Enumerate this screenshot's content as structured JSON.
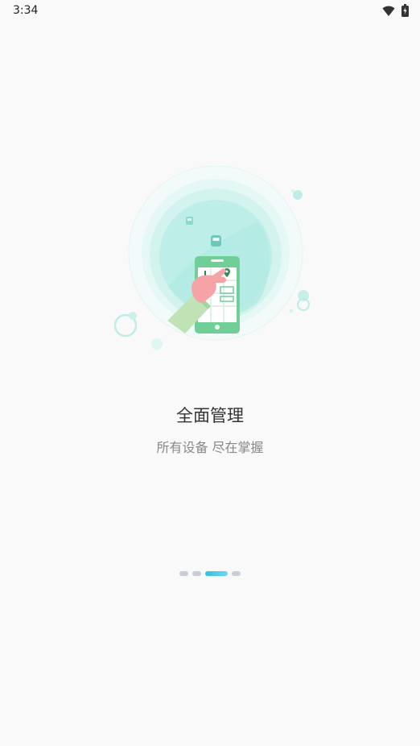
{
  "status_bar": {
    "time": "3:34",
    "icons": [
      "wifi-icon",
      "battery-charging-icon"
    ]
  },
  "onboarding": {
    "title": "全面管理",
    "subtitle": "所有设备 尽在掌握",
    "pager": {
      "total": 4,
      "active_index": 2
    },
    "colors": {
      "accent": "#2ec0e2",
      "circle_inner": "#bdeee8",
      "phone": "#6fcf97",
      "inactive_dot": "#c9cdd6"
    }
  }
}
